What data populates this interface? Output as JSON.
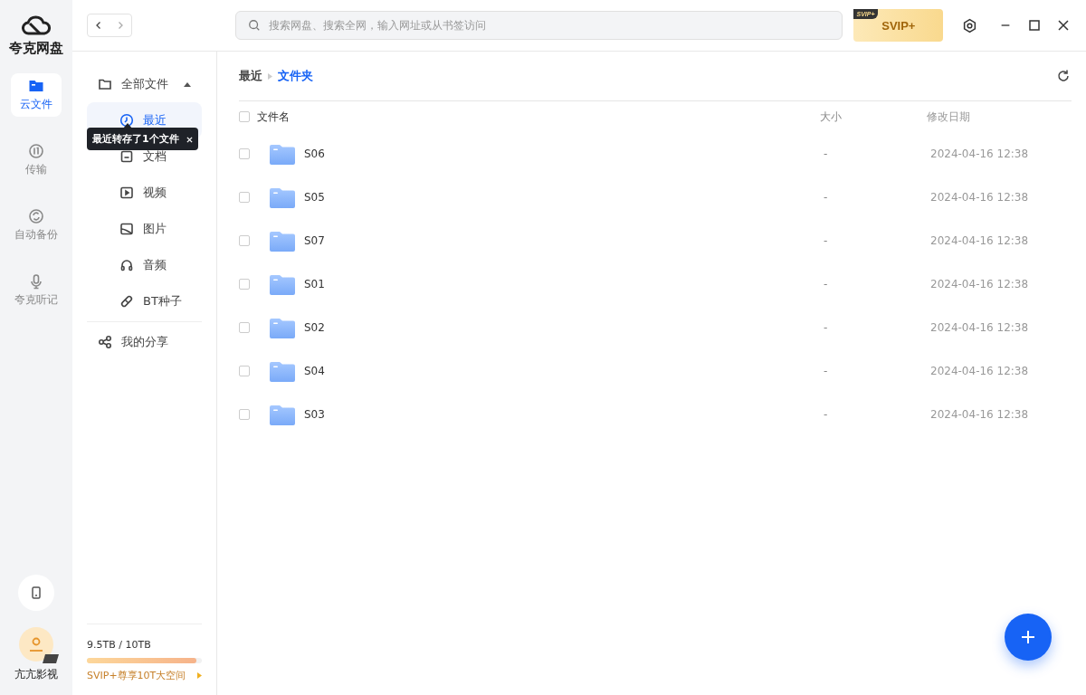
{
  "app": {
    "name": "夸克网盘"
  },
  "rail": [
    {
      "label": "云文件",
      "selected": true
    },
    {
      "label": "传输",
      "selected": false
    },
    {
      "label": "自动备份",
      "selected": false
    },
    {
      "label": "夸克听记",
      "selected": false
    }
  ],
  "user": {
    "name": "亢亢影视"
  },
  "search": {
    "placeholder": "搜索网盘、搜索全网，输入网址或从书签访问"
  },
  "vip_badge": {
    "label": "SVIP+",
    "tag": "SVIP+"
  },
  "sidebar": {
    "items": [
      {
        "label": "全部文件",
        "selected": false,
        "expanded": true,
        "children": [
          {
            "label": "最近",
            "selected": true
          },
          {
            "label": "文档",
            "selected": false
          },
          {
            "label": "视频",
            "selected": false
          },
          {
            "label": "图片",
            "selected": false
          },
          {
            "label": "音频",
            "selected": false
          },
          {
            "label": "BT种子",
            "selected": false
          }
        ]
      },
      {
        "label": "我的分享",
        "selected": false
      }
    ],
    "tooltip": "最近转存了1个文件"
  },
  "storage": {
    "usage": "9.5TB / 10TB",
    "level": 0.95,
    "promo": "SVIP+尊享10T大空间"
  },
  "breadcrumb": [
    {
      "label": "最近",
      "current": false
    },
    {
      "label": "文件夹",
      "current": true
    }
  ],
  "table": {
    "all_checked": false,
    "columns": [
      "文件名",
      "大小",
      "修改日期"
    ],
    "rows": [
      {
        "name": "S06",
        "size": "-",
        "date": "2024-04-16 12:38",
        "checked": false
      },
      {
        "name": "S05",
        "size": "-",
        "date": "2024-04-16 12:38",
        "checked": false
      },
      {
        "name": "S07",
        "size": "-",
        "date": "2024-04-16 12:38",
        "checked": false
      },
      {
        "name": "S01",
        "size": "-",
        "date": "2024-04-16 12:38",
        "checked": false
      },
      {
        "name": "S02",
        "size": "-",
        "date": "2024-04-16 12:38",
        "checked": false
      },
      {
        "name": "S04",
        "size": "-",
        "date": "2024-04-16 12:38",
        "checked": false
      },
      {
        "name": "S03",
        "size": "-",
        "date": "2024-04-16 12:38",
        "checked": false
      }
    ]
  }
}
